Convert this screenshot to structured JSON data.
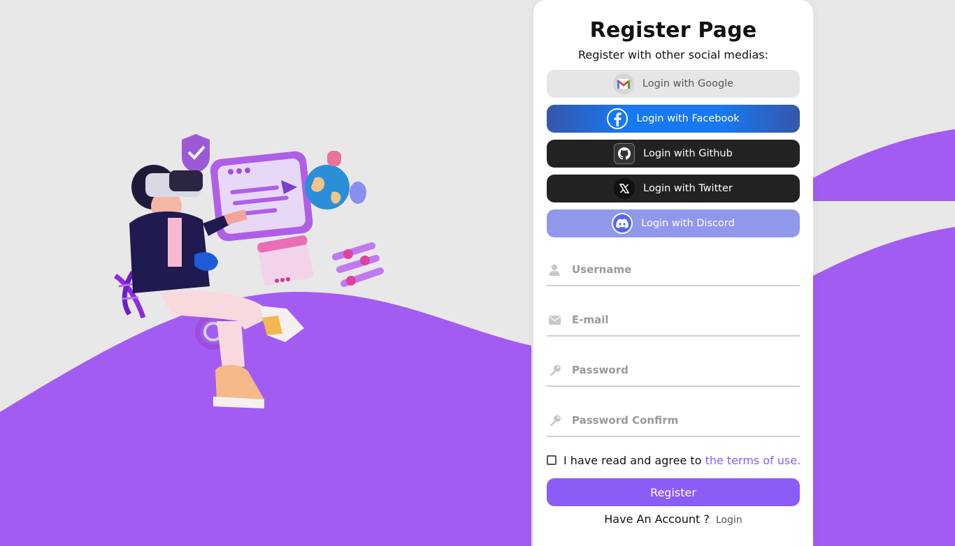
{
  "page": {
    "title": "Register Page",
    "subtitle": "Register with other social medias:"
  },
  "social": {
    "google": "Login with Google",
    "facebook": "Login with Facebook",
    "github": "Login with Github",
    "twitter": "Login with Twitter",
    "discord": "Login with Discord"
  },
  "form": {
    "username_placeholder": "Username",
    "email_placeholder": "E-mail",
    "password_placeholder": "Password",
    "password_confirm_placeholder": "Password Confirm",
    "agree_text": "I have read and agree to",
    "terms_link": "the terms of use.",
    "register_label": "Register",
    "have_account": "Have An Account ?",
    "login_link": "Login"
  },
  "icons": {
    "google": "gmail-icon",
    "facebook": "facebook-icon",
    "github": "github-icon",
    "twitter": "x-icon",
    "discord": "discord-icon",
    "username": "user-icon",
    "email": "envelope-icon",
    "password": "key-icon",
    "password_confirm": "key-icon"
  },
  "colors": {
    "accent": "#8b5cf6",
    "wave": "#a35cf2",
    "background": "#e8e8e8",
    "facebook": "#1877f2",
    "discord": "#9098ec",
    "dark_button": "#222222"
  }
}
